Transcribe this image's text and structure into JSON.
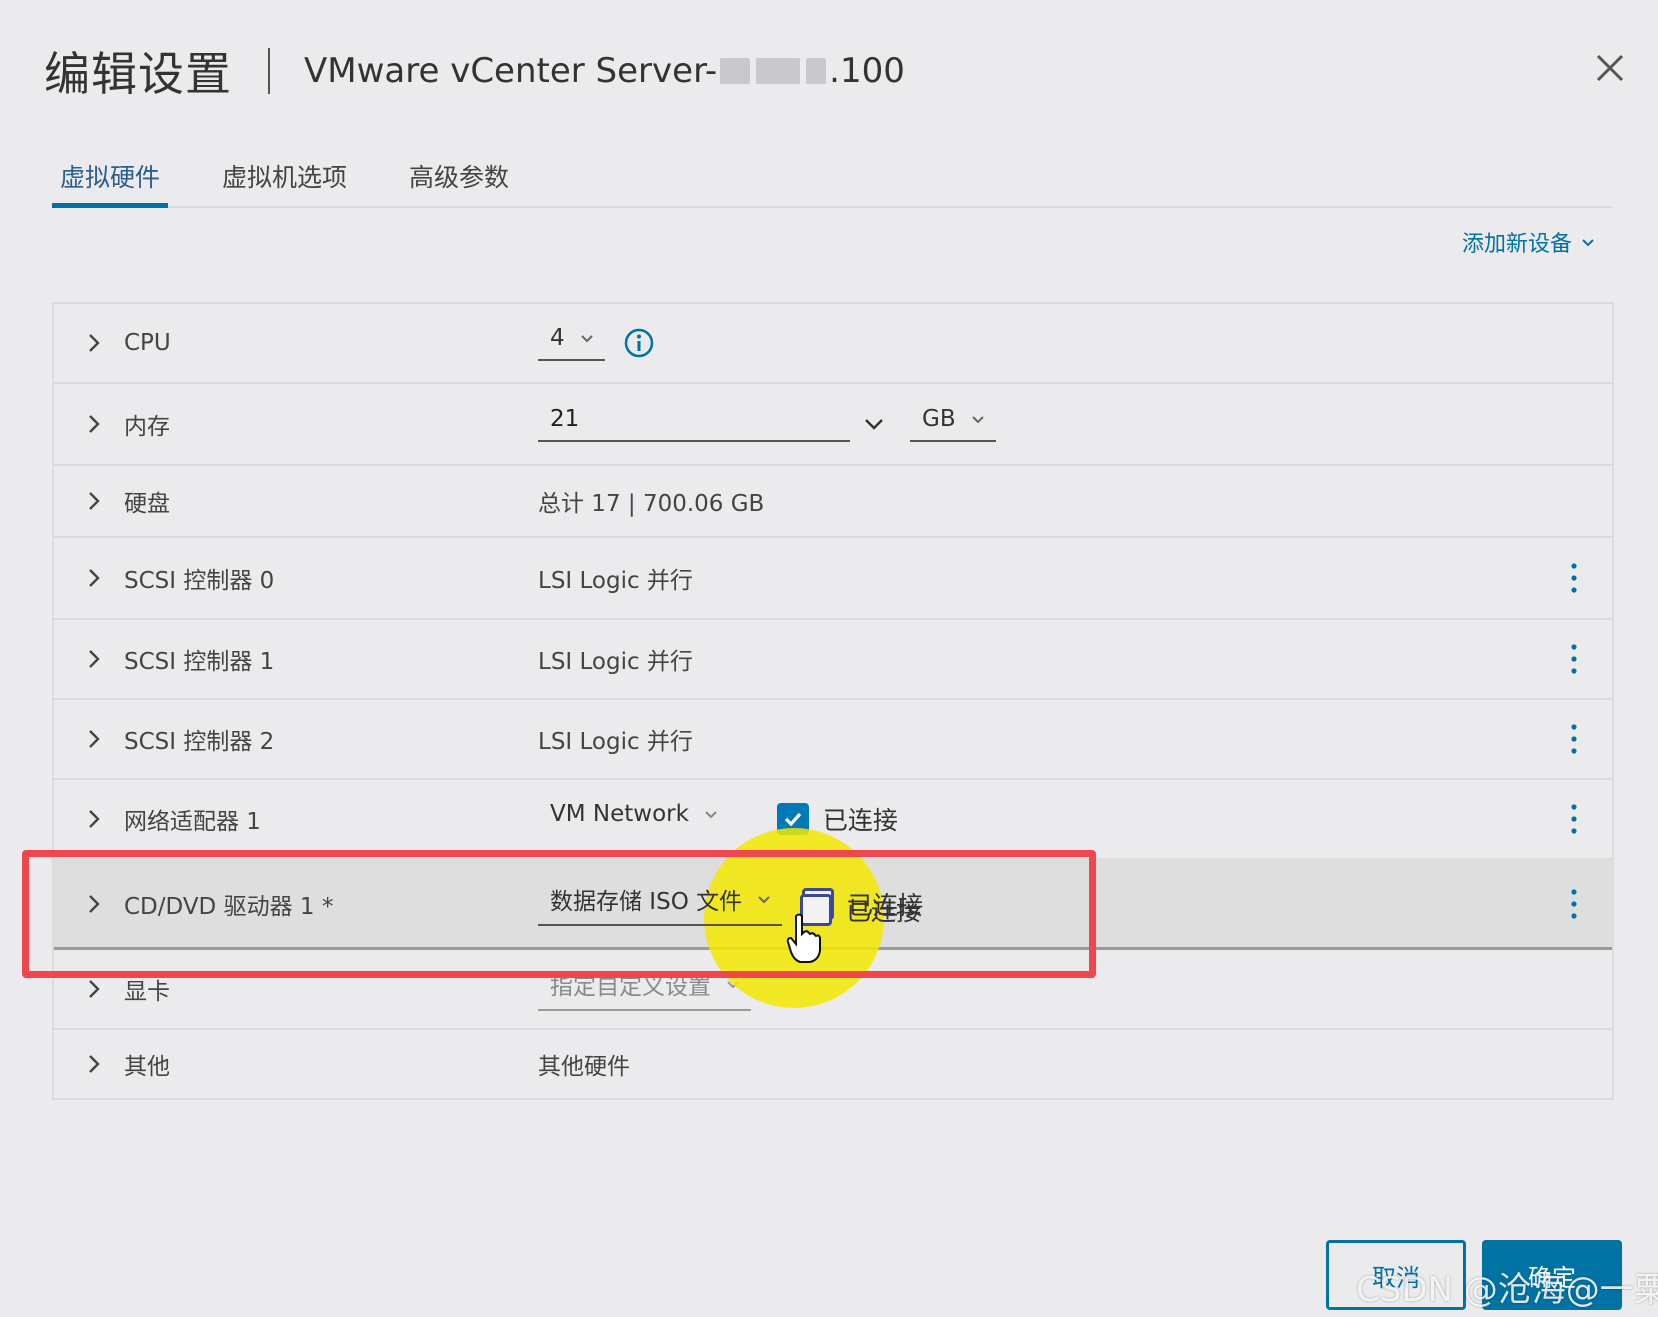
{
  "dialog": {
    "title": "编辑设置",
    "vm_name_prefix": "VMware vCenter Server-",
    "vm_name_suffix": ".100"
  },
  "tabs": [
    {
      "label": "虚拟硬件",
      "active": true
    },
    {
      "label": "虚拟机选项",
      "active": false
    },
    {
      "label": "高级参数",
      "active": false
    }
  ],
  "add_device": {
    "label": "添加新设备"
  },
  "hardware": {
    "cpu": {
      "label": "CPU",
      "value": "4"
    },
    "memory": {
      "label": "内存",
      "value": "21",
      "unit": "GB"
    },
    "disk": {
      "label": "硬盘",
      "value": "总计 17 | 700.06 GB"
    },
    "scsi0": {
      "label": "SCSI 控制器 0",
      "value": "LSI Logic 并行"
    },
    "scsi1": {
      "label": "SCSI 控制器 1",
      "value": "LSI Logic 并行"
    },
    "scsi2": {
      "label": "SCSI 控制器 2",
      "value": "LSI Logic 并行"
    },
    "network": {
      "label": "网络适配器 1",
      "value": "VM Network",
      "connected_label": "已连接",
      "connected": true
    },
    "cddvd": {
      "label": "CD/DVD 驱动器 1 *",
      "value": "数据存储 ISO 文件",
      "connected_label": "已连接",
      "connected": false
    },
    "video": {
      "label": "显卡",
      "value": "指定自定义设置"
    },
    "other": {
      "label": "其他",
      "value": "其他硬件"
    }
  },
  "footer": {
    "cancel_label": "取消",
    "ok_label": "确定"
  },
  "watermark": "CSDN @沧海@一粟!",
  "colors": {
    "accent": "#0072a3",
    "highlight_frame": "#f0474f",
    "cursor_halo": "#f3e700",
    "checkbox_checked": "#0079b8"
  }
}
